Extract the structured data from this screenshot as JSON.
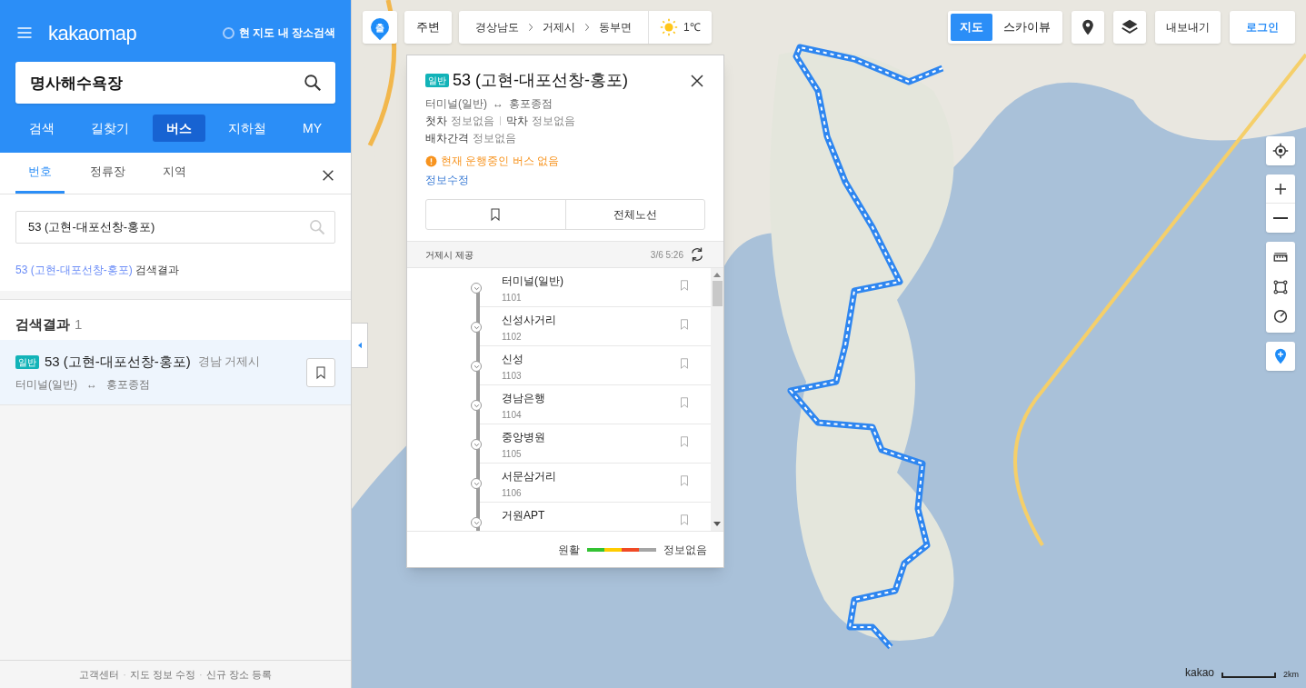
{
  "header": {
    "logo": "kakaomap",
    "area_search": {
      "label": "현 지도 내 장소검색",
      "checked": false
    }
  },
  "search": {
    "value": "명사해수욕장"
  },
  "nav_tabs": [
    {
      "label": "검색",
      "selected": false
    },
    {
      "label": "길찾기",
      "selected": false
    },
    {
      "label": "버스",
      "selected": true
    },
    {
      "label": "지하철",
      "selected": false
    },
    {
      "label": "MY",
      "selected": false
    }
  ],
  "sub_tabs": [
    {
      "label": "번호",
      "selected": true
    },
    {
      "label": "정류장",
      "selected": false
    },
    {
      "label": "지역",
      "selected": false
    }
  ],
  "bus_search": {
    "value": "53 (고현-대포선창-홍포)"
  },
  "suggestion": {
    "link": "53 (고현-대포선창-홍포)",
    "suffix": "검색결과"
  },
  "results": {
    "title": "검색결과",
    "count": "1",
    "items": [
      {
        "badge": "일반",
        "name": "53 (고현-대포선창-홍포)",
        "region": "경남 거제시",
        "from": "터미널(일반)",
        "arrow": "↔",
        "to": "홍포종점",
        "selected": true
      }
    ]
  },
  "footer_links": [
    {
      "label": "고객센터"
    },
    {
      "label": "지도 정보 수정"
    },
    {
      "label": "신규 장소 등록"
    }
  ],
  "footer_separator": "·",
  "map_toolbar": {
    "start_marker": "출",
    "nearby": "주변",
    "breadcrumb": [
      "경상남도",
      "거제시",
      "동부면"
    ],
    "weather": "1℃",
    "map_types": [
      {
        "label": "지도",
        "selected": true
      },
      {
        "label": "스카이뷰",
        "selected": false
      }
    ],
    "export": "내보내기",
    "login": "로그인"
  },
  "route_popup": {
    "badge": "일반",
    "title": "53 (고현-대포선창-홍포)",
    "from": "터미널(일반)",
    "arrow": "↔",
    "to": "홍포종점",
    "first_label": "첫차",
    "first_value": "정보없음",
    "last_label": "막차",
    "last_value": "정보없음",
    "interval_label": "배차간격",
    "interval_value": "정보없음",
    "alert": "현재 운행중인 버스 없음",
    "edit_link": "정보수정",
    "full_route": "전체노선",
    "provider": "거제시 제공",
    "updated": "3/6 5:26",
    "stops": [
      {
        "name": "터미널(일반)",
        "code": "1101"
      },
      {
        "name": "신성사거리",
        "code": "1102"
      },
      {
        "name": "신성",
        "code": "1103"
      },
      {
        "name": "경남은행",
        "code": "1104"
      },
      {
        "name": "중앙병원",
        "code": "1105"
      },
      {
        "name": "서문삼거리",
        "code": "1106"
      },
      {
        "name": "거원APT"
      }
    ],
    "legend": {
      "good": "원활",
      "none": "정보없음",
      "segments": [
        {
          "color": "#33c233"
        },
        {
          "color": "#ffcc00"
        },
        {
          "color": "#f04a25"
        },
        {
          "color": "#a5a5a5"
        }
      ]
    }
  },
  "scale": {
    "logo": "kakao",
    "distance": "2km"
  }
}
